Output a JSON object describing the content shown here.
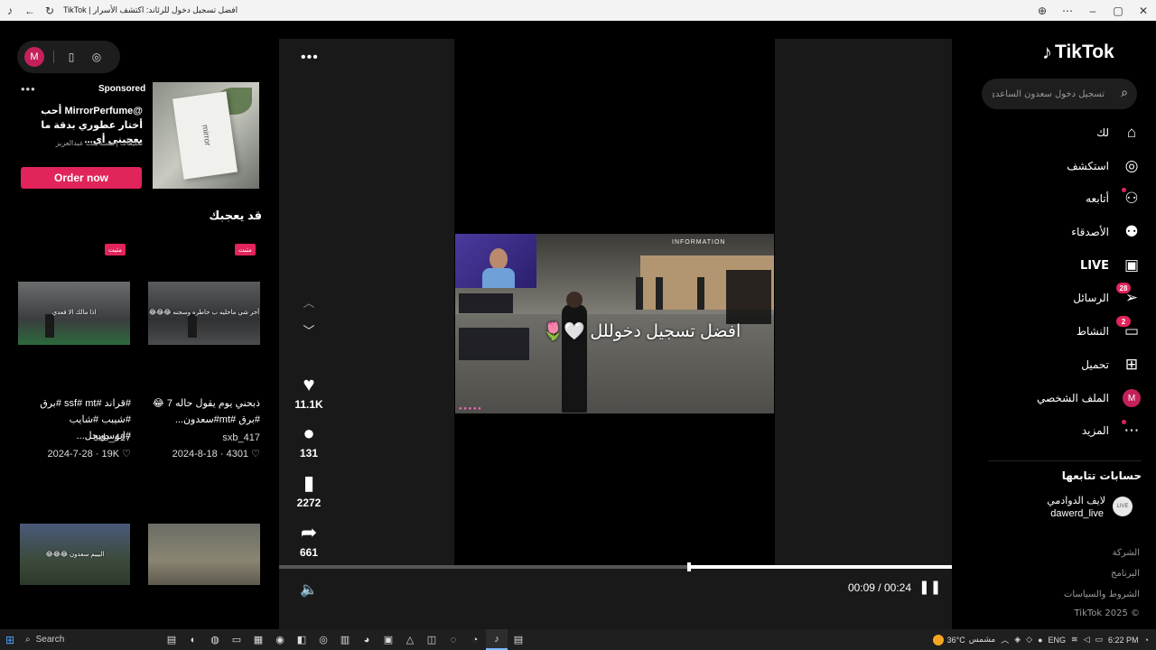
{
  "window": {
    "title": "TikTok | افضل تسجيل دخول للرئاند: اكتشف الأسرار"
  },
  "mini_bar": {
    "avatar_letter": "M"
  },
  "ad": {
    "sponsored": "Sponsored",
    "text_line1": "@MirrorPerfume أحب",
    "text_line2": "أختار عطوري بدقة ما يعجبني أي...",
    "sub": "تعليقات إحسبه بنت عبدالعزيز",
    "button": "Order now",
    "image_text": "mirror"
  },
  "recommend": {
    "heading": "قد يعجبك",
    "pinned_label": "مثبت",
    "videos": [
      {
        "thumb_caption": "أخر شي ماخليه ب خاطره وسجنه 😂😂😂",
        "title_line1": "ذبحني يوم يقول حاله 7 😂",
        "title_line2": "#برق #mt#سعدون...",
        "user": "sxb_417",
        "date": "2024-8-18",
        "likes": "4301"
      },
      {
        "thumb_caption": "اذا مالك الا فعدي",
        "title_line1": "#قراند #ssf# mt #برق",
        "title_line2": "#شيبب #شايب #ابوسويحل...",
        "user": "sxb_417",
        "date": "2024-7-28",
        "likes": "19K"
      },
      {
        "thumb_caption": "اليييم سعدون 😂😂😂"
      },
      {
        "thumb_caption": ""
      }
    ]
  },
  "player": {
    "caption": "افضل تسجيل دخوللل 🤍🌷",
    "scene_sign": "INFORMATION",
    "likes": "11.1K",
    "comments": "131",
    "saves": "2272",
    "shares": "661",
    "time": "00:09 / 00:24",
    "progress": 0.61,
    "next_user": "sxb_417"
  },
  "sidebar": {
    "logo": "TikTok",
    "search_placeholder": "تسجيل دخول سعدون الساعدي",
    "nav": [
      {
        "label": "لك",
        "icon": "home-icon"
      },
      {
        "label": "استكشف",
        "icon": "compass-icon"
      },
      {
        "label": "أتابعه",
        "icon": "following-icon"
      },
      {
        "label": "الأصدقاء",
        "icon": "friends-icon"
      },
      {
        "label": "LIVE",
        "icon": "live-icon"
      },
      {
        "label": "الرسائل",
        "icon": "messages-icon",
        "badge": "28"
      },
      {
        "label": "النشاط",
        "icon": "activity-icon",
        "badge": "2"
      },
      {
        "label": "تحميل",
        "icon": "upload-icon"
      },
      {
        "label": "الملف الشخصي",
        "icon": "profile-icon",
        "avatar": "M"
      },
      {
        "label": "المزيد",
        "icon": "more-icon"
      }
    ],
    "following_heading": "حسابات تتابعها",
    "following": {
      "name": "لايف الدوادمي",
      "handle": "dawerd_live"
    },
    "footer": [
      "الشركة",
      "البرنامج",
      "الشروط والسياسات",
      "TikTok 2025 ©"
    ]
  },
  "taskbar": {
    "search": "Search",
    "weather": "36°C",
    "weather_label": "مشمس",
    "lang": "ENG",
    "time": "6:22 PM"
  }
}
